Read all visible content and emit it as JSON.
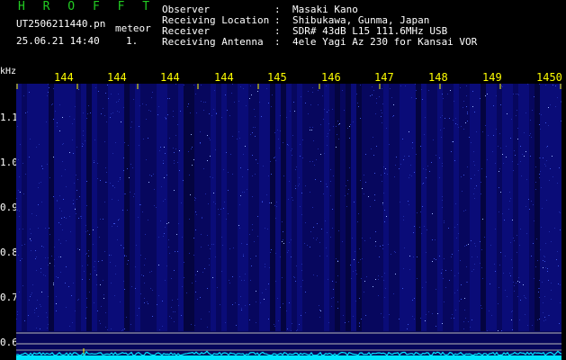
{
  "header": {
    "app_title": "H R O F F T",
    "file_name": "UT2506211440.pn",
    "mode": "meteor",
    "datetime": "25.06.21 14:40",
    "scale": "1."
  },
  "info": {
    "rows": [
      {
        "label": "Observer",
        "value": "Masaki Kano"
      },
      {
        "label": "Receiving Location",
        "value": "Shibukawa, Gunma, Japan"
      },
      {
        "label": "Receiver",
        "value": "SDR# 43dB L15 111.6MHz USB"
      },
      {
        "label": "Receiving Antenna",
        "value": "4ele Yagi Az 230 for Kansai VOR"
      }
    ],
    "colon": ":"
  },
  "axis": {
    "unit": "kHz",
    "x_ticks": [
      "144",
      "144",
      "144",
      "144",
      "145",
      "146",
      "147",
      "148",
      "149",
      "1450"
    ],
    "y_ticks": [
      "1.1",
      "1.0",
      "0.9",
      "0.8",
      "0.7",
      "0.6"
    ]
  },
  "colors": {
    "title": "#22cc22",
    "text": "#ffffff",
    "tick": "#ffff00",
    "waterfall_bg": "#06065a",
    "trace": "#00e5ff"
  }
}
